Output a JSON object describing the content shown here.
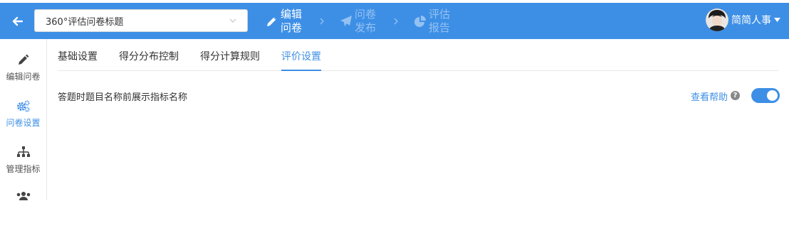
{
  "header": {
    "survey_title": "360°评估问卷标题",
    "steps": [
      {
        "label": "编辑问卷",
        "icon": "pencil-icon",
        "state": "active"
      },
      {
        "label": "问卷发布",
        "icon": "paper-plane-icon",
        "state": "inactive"
      },
      {
        "label": "评估报告",
        "icon": "pie-chart-icon",
        "state": "inactive"
      }
    ],
    "user_name": "简简人事"
  },
  "sidebar": {
    "items": [
      {
        "label": "编辑问卷",
        "icon": "pencil-icon"
      },
      {
        "label": "问卷设置",
        "icon": "gears-icon",
        "active": true
      },
      {
        "label": "管理指标",
        "icon": "sitemap-icon"
      },
      {
        "label": "",
        "icon": "users-icon"
      }
    ]
  },
  "tabs": [
    {
      "label": "基础设置"
    },
    {
      "label": "得分分布控制"
    },
    {
      "label": "得分计算规则"
    },
    {
      "label": "评价设置",
      "active": true
    }
  ],
  "setting": {
    "label": "答题时题目名称前展示指标名称",
    "help_link": "查看帮助",
    "help_icon_glyph": "?",
    "toggle_on": true
  },
  "colors": {
    "primary": "#3d8fe6",
    "header_bg": "#3d8fe6"
  }
}
